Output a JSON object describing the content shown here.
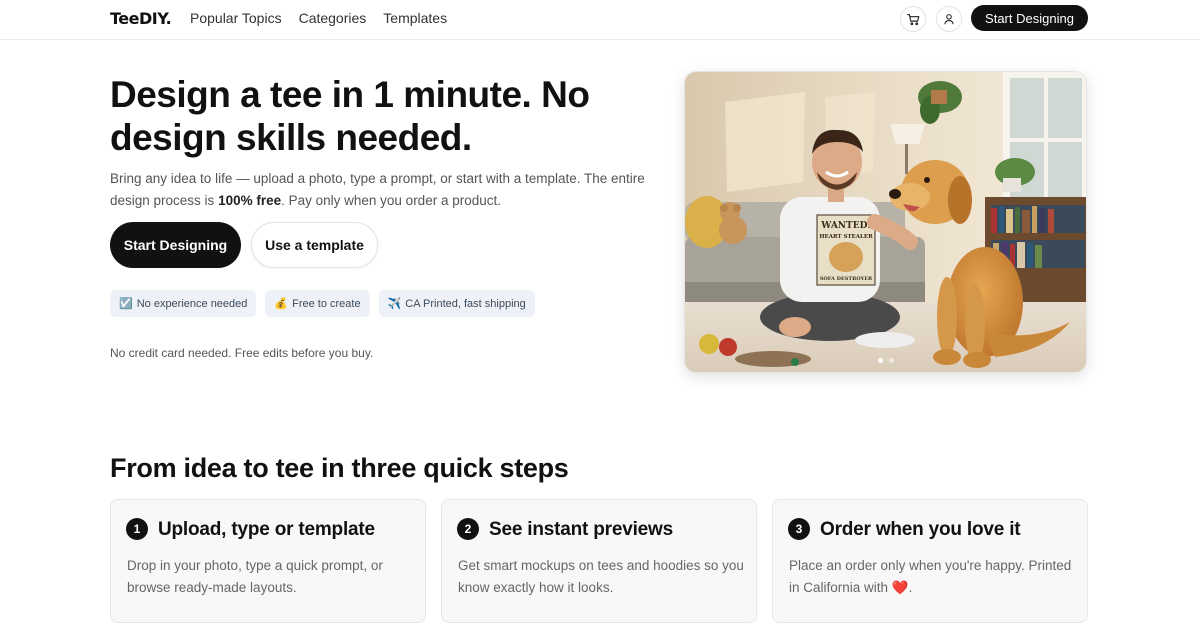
{
  "header": {
    "logo": "TeeDIY.",
    "nav": [
      "Popular Topics",
      "Categories",
      "Templates"
    ],
    "cart_icon": "cart-icon",
    "user_icon": "user-icon",
    "cta": "Start Designing"
  },
  "hero": {
    "title": "Design a tee in 1 minute. No design skills needed.",
    "desc_before": "Bring any idea to life — upload a photo, type a prompt, or start with a template. The entire design process is ",
    "desc_bold": "100% free",
    "desc_after": ". Pay only when you order a product.",
    "cta_primary": "Start Designing",
    "cta_secondary": "Use a template",
    "badges": [
      {
        "emoji": "☑️",
        "text": "No experience needed"
      },
      {
        "emoji": "💰",
        "text": "Free to create"
      },
      {
        "emoji": "✈️",
        "text": "CA Printed, fast shipping"
      }
    ],
    "note": "No credit card needed. Free edits before you buy.",
    "image_shirt_text": [
      "WANTED:",
      "HEART STEALER",
      "SOFA DESTROYER"
    ],
    "carousel": {
      "total": 2,
      "active": 1
    }
  },
  "steps": {
    "title": "From idea to tee in three quick steps",
    "items": [
      {
        "num": "1",
        "title": "Upload, type or template",
        "desc": "Drop in your photo, type a quick prompt, or browse ready-made layouts."
      },
      {
        "num": "2",
        "title": "See instant previews",
        "desc": "Get smart mockups on tees and hoodies so you know exactly how it looks."
      },
      {
        "num": "3",
        "title": "Order when you love it",
        "desc": "Place an order only when you're happy. Printed in California with ❤️."
      }
    ]
  },
  "colors": {
    "accent": "#111111",
    "badge_bg": "#eef2f8",
    "card_bg": "#f8f8f8"
  }
}
